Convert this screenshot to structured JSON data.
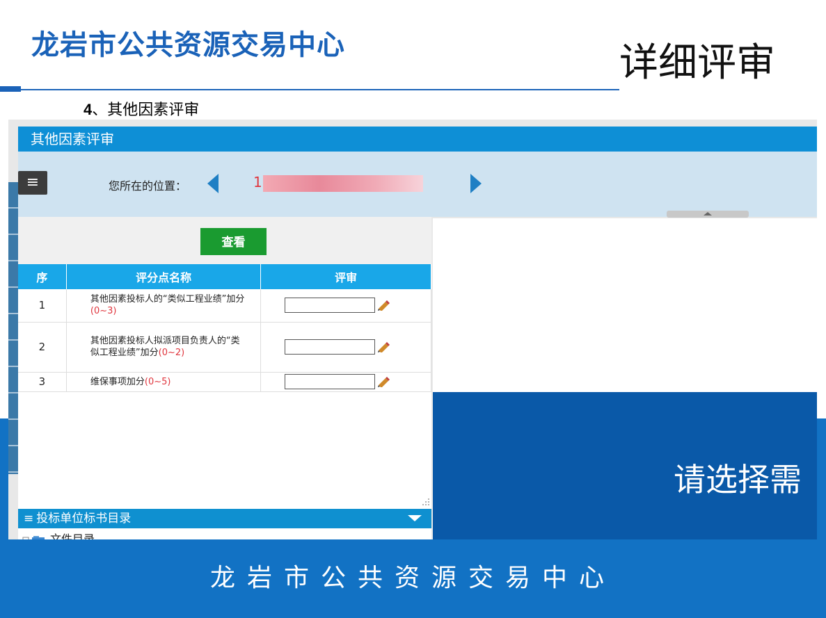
{
  "slide": {
    "org_title": "龙岩市公共资源交易中心",
    "title": "详细评审",
    "section_number": "4",
    "section_title": "、其他因素评审",
    "footer": "龙岩市公共资源交易中心"
  },
  "app": {
    "window_title": "其他因素评审",
    "location_label": "您所在的位置：",
    "location_value": "1",
    "view_button": "查看",
    "table": {
      "headers": [
        "序",
        "评分点名称",
        "评审"
      ],
      "rows": [
        {
          "no": "1",
          "name": "其他因素投标人的“类似工程业绩”加分",
          "range": "(0~3)",
          "score": ""
        },
        {
          "no": "2",
          "name": "其他因素投标人拟派项目负责人的“类似工程业绩”加分",
          "range": "(0~2)",
          "score": ""
        },
        {
          "no": "3",
          "name": "维保事项加分",
          "range": "(0~5)",
          "score": ""
        }
      ]
    },
    "directory_title": "投标单位标书目录",
    "directory_item": "文件目录",
    "right_prompt": "请选择需"
  },
  "colors": {
    "brand_blue": "#1a62b8",
    "titlebar": "#0e8fd6",
    "table_header": "#19a7e8",
    "view_button": "#1a9b30",
    "range_red": "#e0353d",
    "band_blue": "#1272c4"
  },
  "icons": [
    "menu-icon",
    "nav-left-icon",
    "nav-right-icon",
    "pencil-icon",
    "collapse-up-icon",
    "chevron-down-icon",
    "folder-icon"
  ]
}
